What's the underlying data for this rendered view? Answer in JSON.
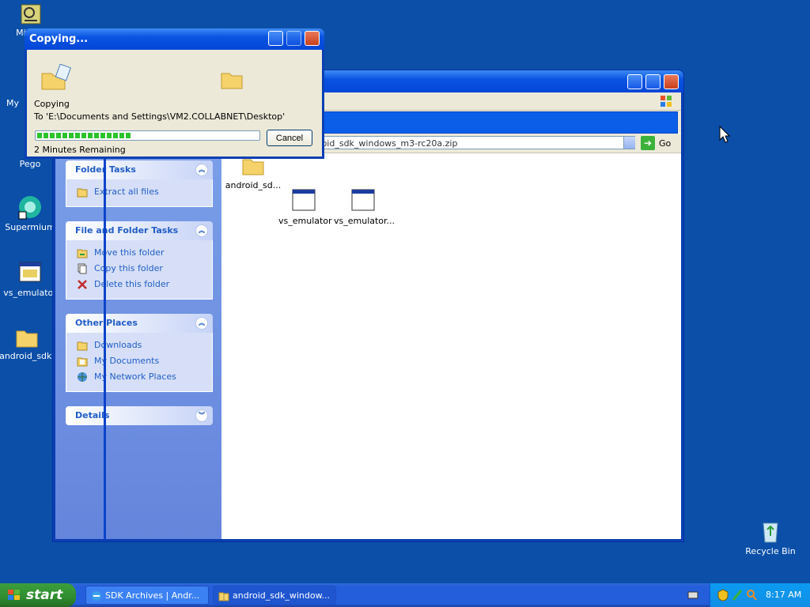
{
  "desktop": {
    "icons": [
      {
        "label": "Mic Ou",
        "icon": "outlook-icon"
      },
      {
        "label": "My",
        "icon": "my-computer-icon"
      },
      {
        "label": "Pego",
        "icon": "pego-icon"
      },
      {
        "label": "Supermium",
        "icon": "supermium-icon"
      },
      {
        "label": "vs_emulator",
        "icon": "app-window-icon"
      },
      {
        "label": "android_sdk.",
        "icon": "folder-icon"
      },
      {
        "label": "Recycle Bin",
        "icon": "recycle-bin-icon"
      }
    ]
  },
  "explorer": {
    "address": "ents\\Downloads\\android_sdk_windows_m3-rc20a.zip",
    "go_label": "Go",
    "folder_tasks": {
      "title": "Folder Tasks",
      "items": [
        {
          "label": "Extract all files",
          "icon": "extract-icon"
        }
      ]
    },
    "file_folder_tasks": {
      "title": "File and Folder Tasks",
      "items": [
        {
          "label": "Move this folder",
          "icon": "move-icon"
        },
        {
          "label": "Copy this folder",
          "icon": "copy-icon"
        },
        {
          "label": "Delete this folder",
          "icon": "delete-icon"
        }
      ]
    },
    "other_places": {
      "title": "Other Places",
      "items": [
        {
          "label": "Downloads",
          "icon": "folder-icon"
        },
        {
          "label": "My Documents",
          "icon": "documents-icon"
        },
        {
          "label": "My Network Places",
          "icon": "network-icon"
        }
      ]
    },
    "details": {
      "title": "Details"
    },
    "files": [
      {
        "label": "android_sd...",
        "icon": "folder-icon"
      },
      {
        "label": "vs_emulator",
        "icon": "app-window-icon"
      },
      {
        "label": "vs_emulator...",
        "icon": "app-window-icon"
      }
    ]
  },
  "copy_dialog": {
    "title": "Copying...",
    "status": "Copying",
    "destination": "To 'E:\\Documents and Settings\\VM2.COLLABNET\\Desktop'",
    "remaining": "2 Minutes Remaining",
    "progress": 0.43,
    "cancel_label": "Cancel"
  },
  "taskbar": {
    "start_label": "start",
    "tasks": [
      {
        "label": "SDK Archives  |  Andr...",
        "icon": "ie-icon"
      },
      {
        "label": "android_sdk_window...",
        "icon": "zip-folder-icon"
      }
    ],
    "clock": "8:17 AM"
  },
  "colors": {
    "desktop": "#0b4fa8",
    "title_bar": "#0a54e2",
    "taskpane_link": "#215dc6",
    "start_green": "#2f8d2f"
  }
}
